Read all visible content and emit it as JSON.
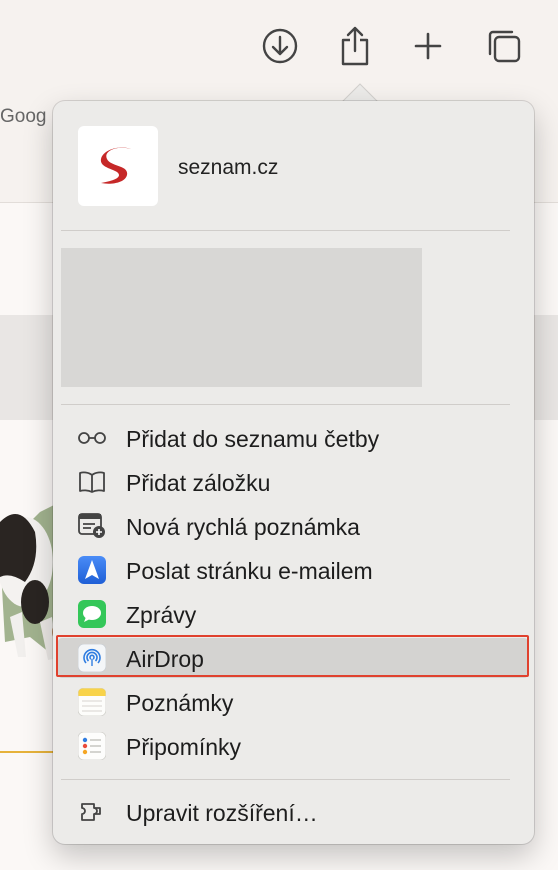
{
  "toolbar": {
    "icons": [
      "download-icon",
      "share-icon",
      "new-tab-plus-icon",
      "tabs-overview-icon"
    ]
  },
  "bookmarks_bar": {
    "visible_text": "Goog"
  },
  "share_sheet": {
    "site_title": "seznam.cz",
    "menu_items": [
      {
        "label": "Přidat do seznamu četby",
        "icon": "reading-list-glasses-icon"
      },
      {
        "label": "Přidat záložku",
        "icon": "bookmark-book-icon"
      },
      {
        "label": "Nová rychlá poznámka",
        "icon": "quick-note-icon"
      },
      {
        "label": "Poslat stránku e-mailem",
        "icon": "mail-app-icon"
      },
      {
        "label": "Zprávy",
        "icon": "messages-app-icon"
      },
      {
        "label": "AirDrop",
        "icon": "airdrop-icon",
        "highlighted": true
      },
      {
        "label": "Poznámky",
        "icon": "notes-app-icon"
      },
      {
        "label": "Připomínky",
        "icon": "reminders-app-icon"
      }
    ],
    "footer_item": {
      "label": "Upravit rozšíření…",
      "icon": "extensions-icon"
    }
  },
  "colors": {
    "highlight_border": "#e0412e",
    "seznam_red": "#c62828",
    "mail_blue": "#2f6de0",
    "messages_green": "#34c759"
  }
}
